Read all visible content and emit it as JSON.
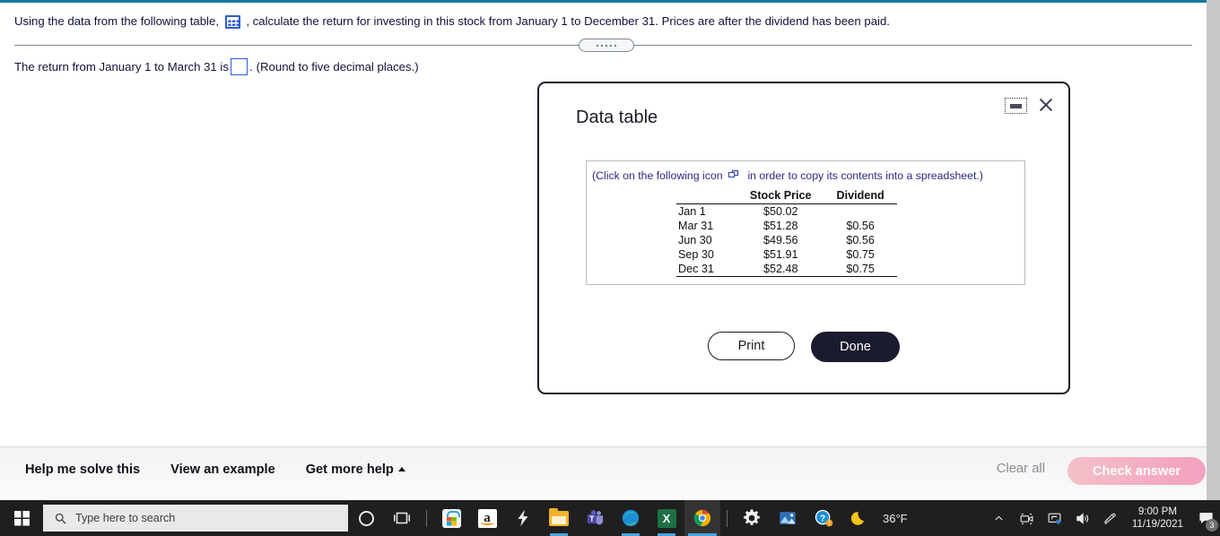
{
  "question": {
    "text_before_icon": "Using the data from the following table,",
    "table_icon": "grid-table-icon",
    "text_after_icon": ", calculate the return for investing in this stock from January 1 to December 31. Prices are after the dividend has been paid.",
    "answer_prompt": "The return from January 1 to March 31 is",
    "answer_value": "",
    "answer_suffix": ".",
    "rounding_hint": "(Round to five decimal places.)"
  },
  "modal": {
    "title": "Data table",
    "minimize_icon": "minimize-icon",
    "close_icon": "close-icon",
    "copy_hint_before": "(Click on the following icon",
    "copy_icon": "copy-icon",
    "copy_hint_after": "in order to copy its contents into a spreadsheet.)",
    "print_label": "Print",
    "done_label": "Done"
  },
  "chart_data": {
    "type": "table",
    "title": "Data table",
    "columns": [
      "",
      "Stock Price",
      "Dividend"
    ],
    "rows": [
      {
        "date": "Jan 1",
        "stock_price": "$50.02",
        "dividend": ""
      },
      {
        "date": "Mar 31",
        "stock_price": "$51.28",
        "dividend": "$0.56"
      },
      {
        "date": "Jun 30",
        "stock_price": "$49.56",
        "dividend": "$0.56"
      },
      {
        "date": "Sep 30",
        "stock_price": "$51.91",
        "dividend": "$0.75"
      },
      {
        "date": "Dec 31",
        "stock_price": "$52.48",
        "dividend": "$0.75"
      }
    ]
  },
  "help_bar": {
    "links": [
      {
        "label": "Help me solve this",
        "caret": false
      },
      {
        "label": "View an example",
        "caret": false
      },
      {
        "label": "Get more help",
        "caret": true
      }
    ],
    "clear_all_label": "Clear all",
    "check_answer_label": "Check answer",
    "check_answer_color": "#f3a0c0"
  },
  "taskbar": {
    "start_icon": "windows-start-icon",
    "search_placeholder": "Type here to search",
    "search_icon": "search-icon",
    "items": [
      {
        "name": "cortana-icon"
      },
      {
        "name": "task-view-icon"
      },
      {
        "name": "microsoft-store-icon"
      },
      {
        "name": "amazon-icon"
      },
      {
        "name": "lightning-icon"
      },
      {
        "name": "file-explorer-icon"
      },
      {
        "name": "microsoft-teams-icon"
      },
      {
        "name": "microsoft-edge-icon"
      },
      {
        "name": "microsoft-excel-icon"
      },
      {
        "name": "google-chrome-icon"
      },
      {
        "name": "settings-gear-icon"
      },
      {
        "name": "photos-icon"
      },
      {
        "name": "help-icon"
      }
    ],
    "weather": {
      "icon": "moon-icon",
      "temperature": "36°F"
    },
    "tray": {
      "chevron_up_icon": "chevron-up-icon",
      "meet-now-icon": "meet-now-icon",
      "display-icon": "display-icon",
      "volume-icon": "volume-icon",
      "pen-icon": "pen-icon",
      "time": "9:00 PM",
      "date": "11/19/2021",
      "notifications_count": "3"
    }
  }
}
